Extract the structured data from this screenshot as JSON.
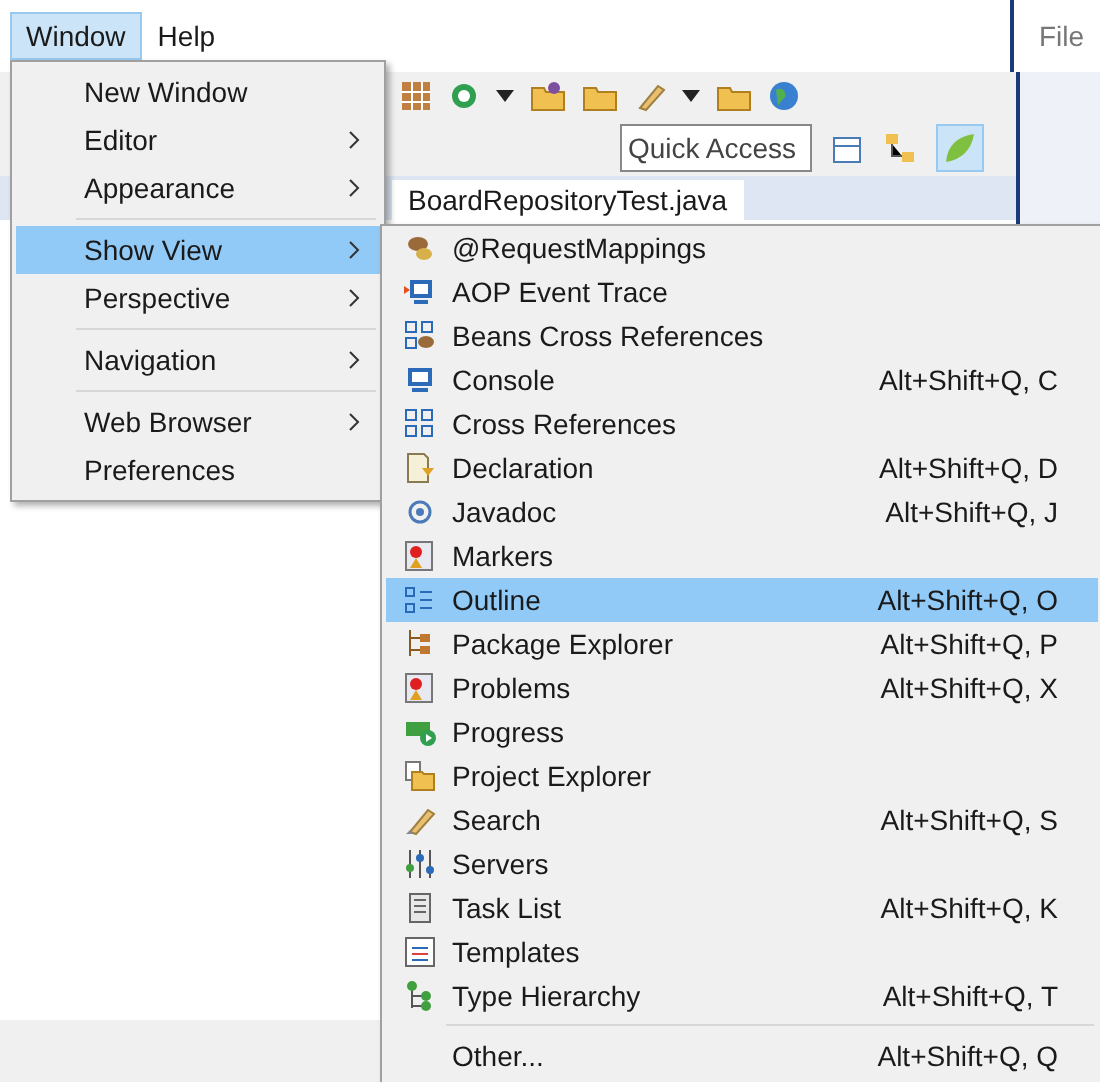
{
  "menubar": [
    {
      "label": "Window",
      "selected": true
    },
    {
      "label": "Help",
      "selected": false
    }
  ],
  "toolbar": {
    "quick_access": {
      "placeholder": "Quick Access"
    }
  },
  "editor_tab": {
    "title": "BoardRepositoryTest.java"
  },
  "second_window": {
    "menubar": [
      "File"
    ]
  },
  "window_menu": {
    "items": [
      {
        "kind": "item",
        "label": "New Window",
        "submenu": false,
        "selected": false
      },
      {
        "kind": "item",
        "label": "Editor",
        "submenu": true,
        "selected": false
      },
      {
        "kind": "item",
        "label": "Appearance",
        "submenu": true,
        "selected": false
      },
      {
        "kind": "separator"
      },
      {
        "kind": "item",
        "label": "Show View",
        "submenu": true,
        "selected": true
      },
      {
        "kind": "item",
        "label": "Perspective",
        "submenu": true,
        "selected": false
      },
      {
        "kind": "separator"
      },
      {
        "kind": "item",
        "label": "Navigation",
        "submenu": true,
        "selected": false
      },
      {
        "kind": "separator"
      },
      {
        "kind": "item",
        "label": "Web Browser",
        "submenu": true,
        "selected": false
      },
      {
        "kind": "item",
        "label": "Preferences",
        "submenu": false,
        "selected": false
      }
    ]
  },
  "show_view_menu": {
    "items": [
      {
        "kind": "item",
        "label": "@RequestMappings",
        "selected": false
      },
      {
        "kind": "item",
        "label": "AOP Event Trace",
        "selected": false
      },
      {
        "kind": "item",
        "label": "Beans Cross References",
        "selected": false
      },
      {
        "kind": "item",
        "label": "Console",
        "shortcut": "Alt+Shift+Q, C",
        "selected": false
      },
      {
        "kind": "item",
        "label": "Cross References",
        "selected": false
      },
      {
        "kind": "item",
        "label": "Declaration",
        "shortcut": "Alt+Shift+Q, D",
        "selected": false
      },
      {
        "kind": "item",
        "label": "Javadoc",
        "shortcut": "Alt+Shift+Q, J",
        "selected": false
      },
      {
        "kind": "item",
        "label": "Markers",
        "selected": false
      },
      {
        "kind": "item",
        "label": "Outline",
        "shortcut": "Alt+Shift+Q, O",
        "selected": true
      },
      {
        "kind": "item",
        "label": "Package Explorer",
        "shortcut": "Alt+Shift+Q, P",
        "selected": false
      },
      {
        "kind": "item",
        "label": "Problems",
        "shortcut": "Alt+Shift+Q, X",
        "selected": false
      },
      {
        "kind": "item",
        "label": "Progress",
        "selected": false
      },
      {
        "kind": "item",
        "label": "Project Explorer",
        "selected": false
      },
      {
        "kind": "item",
        "label": "Search",
        "shortcut": "Alt+Shift+Q, S",
        "selected": false
      },
      {
        "kind": "item",
        "label": "Servers",
        "selected": false
      },
      {
        "kind": "item",
        "label": "Task List",
        "shortcut": "Alt+Shift+Q, K",
        "selected": false
      },
      {
        "kind": "item",
        "label": "Templates",
        "selected": false
      },
      {
        "kind": "item",
        "label": "Type Hierarchy",
        "shortcut": "Alt+Shift+Q, T",
        "selected": false
      },
      {
        "kind": "separator"
      },
      {
        "kind": "item",
        "label": "Other...",
        "shortcut": "Alt+Shift+Q, Q",
        "selected": false
      }
    ]
  }
}
